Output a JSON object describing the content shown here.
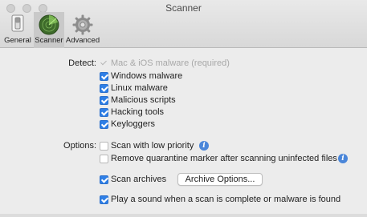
{
  "window": {
    "title": "Scanner"
  },
  "toolbar": {
    "tabs": [
      {
        "label": "General",
        "icon": "general-switch-icon"
      },
      {
        "label": "Scanner",
        "icon": "radar-icon",
        "selected": true
      },
      {
        "label": "Advanced",
        "icon": "gear-icon"
      }
    ]
  },
  "detect": {
    "label": "Detect:",
    "items": [
      {
        "label": "Mac & iOS malware (required)",
        "checked": true,
        "disabled": true
      },
      {
        "label": "Windows malware",
        "checked": true
      },
      {
        "label": "Linux malware",
        "checked": true
      },
      {
        "label": "Malicious scripts",
        "checked": true
      },
      {
        "label": "Hacking tools",
        "checked": true
      },
      {
        "label": "Keyloggers",
        "checked": true
      }
    ]
  },
  "options": {
    "label": "Options:",
    "low_priority": {
      "label": "Scan with low priority",
      "checked": false
    },
    "quarantine": {
      "label": "Remove quarantine marker after scanning uninfected files",
      "checked": false
    },
    "archives": {
      "label": "Scan archives",
      "checked": true,
      "button_label": "Archive Options..."
    },
    "sound": {
      "label": "Play a sound when a scan is complete or malware is found",
      "checked": true
    }
  },
  "colors": {
    "accent": "#2f7fe6",
    "info": "#4a86d9",
    "radar": "#4e8a35"
  }
}
